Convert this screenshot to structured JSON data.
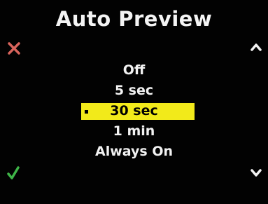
{
  "screen": {
    "title": "Auto Preview",
    "options": [
      {
        "label": "Off",
        "selected": false
      },
      {
        "label": "5 sec",
        "selected": false
      },
      {
        "label": "30 sec",
        "selected": true
      },
      {
        "label": "1 min",
        "selected": false
      },
      {
        "label": "Always On",
        "selected": false
      }
    ]
  },
  "icons": {
    "cancel": "close-icon",
    "confirm": "checkmark-icon",
    "up": "chevron-up-icon",
    "down": "chevron-down-icon"
  },
  "colors": {
    "background": "#020202",
    "text": "#f2f2f2",
    "highlight": "#f2ea1a",
    "cancel": "#d9645c",
    "confirm": "#3fb548"
  }
}
